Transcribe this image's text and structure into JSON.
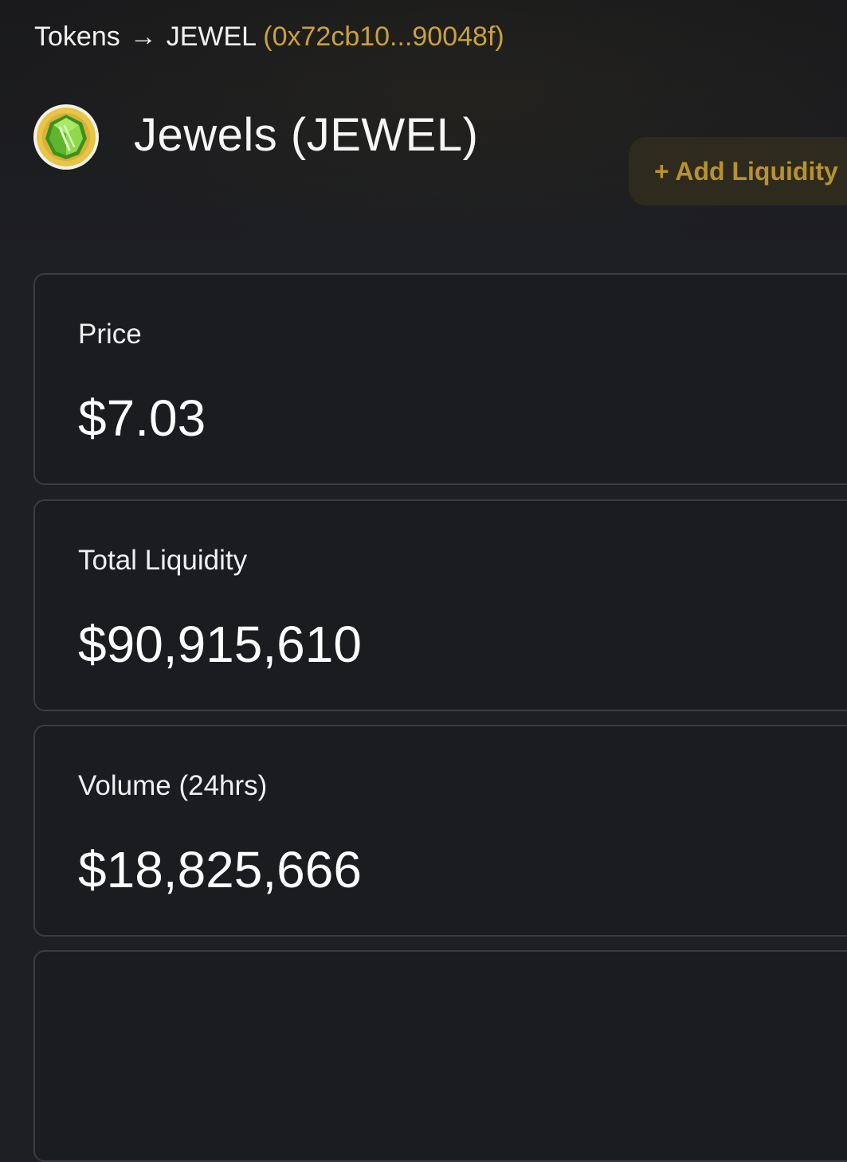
{
  "breadcrumb": {
    "root_label": "Tokens",
    "separator": "→",
    "token_label": "JEWEL",
    "address": "(0x72cb10...90048f)"
  },
  "token": {
    "name": "Jewels (JEWEL)",
    "logo_icon": "jewel-gem-icon",
    "logo_colors": {
      "ring": "#e8c548",
      "gem": "#7ccf3a",
      "gem_dark": "#3f8f1c"
    }
  },
  "actions": {
    "add_liquidity_label": "+ Add Liquidity"
  },
  "stats": [
    {
      "label": "Price",
      "value": "$7.03"
    },
    {
      "label": "Total Liquidity",
      "value": "$90,915,610"
    },
    {
      "label": "Volume (24hrs)",
      "value": "$18,825,666"
    }
  ],
  "colors": {
    "background": "#1e1f23",
    "accent": "#c9a23a",
    "button_bg": "#2e2a1d",
    "button_text": "#b8922f",
    "card_border": "#3a3c44"
  }
}
